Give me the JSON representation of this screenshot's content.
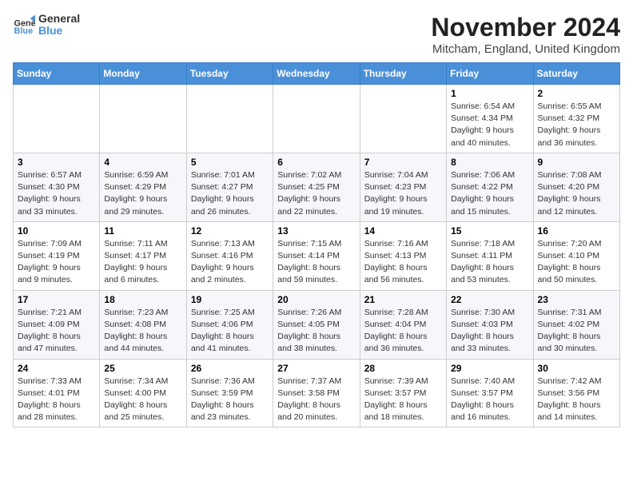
{
  "header": {
    "logo_general": "General",
    "logo_blue": "Blue",
    "month_title": "November 2024",
    "location": "Mitcham, England, United Kingdom"
  },
  "days_of_week": [
    "Sunday",
    "Monday",
    "Tuesday",
    "Wednesday",
    "Thursday",
    "Friday",
    "Saturday"
  ],
  "weeks": [
    [
      {
        "day": "",
        "info": ""
      },
      {
        "day": "",
        "info": ""
      },
      {
        "day": "",
        "info": ""
      },
      {
        "day": "",
        "info": ""
      },
      {
        "day": "",
        "info": ""
      },
      {
        "day": "1",
        "info": "Sunrise: 6:54 AM\nSunset: 4:34 PM\nDaylight: 9 hours\nand 40 minutes."
      },
      {
        "day": "2",
        "info": "Sunrise: 6:55 AM\nSunset: 4:32 PM\nDaylight: 9 hours\nand 36 minutes."
      }
    ],
    [
      {
        "day": "3",
        "info": "Sunrise: 6:57 AM\nSunset: 4:30 PM\nDaylight: 9 hours\nand 33 minutes."
      },
      {
        "day": "4",
        "info": "Sunrise: 6:59 AM\nSunset: 4:29 PM\nDaylight: 9 hours\nand 29 minutes."
      },
      {
        "day": "5",
        "info": "Sunrise: 7:01 AM\nSunset: 4:27 PM\nDaylight: 9 hours\nand 26 minutes."
      },
      {
        "day": "6",
        "info": "Sunrise: 7:02 AM\nSunset: 4:25 PM\nDaylight: 9 hours\nand 22 minutes."
      },
      {
        "day": "7",
        "info": "Sunrise: 7:04 AM\nSunset: 4:23 PM\nDaylight: 9 hours\nand 19 minutes."
      },
      {
        "day": "8",
        "info": "Sunrise: 7:06 AM\nSunset: 4:22 PM\nDaylight: 9 hours\nand 15 minutes."
      },
      {
        "day": "9",
        "info": "Sunrise: 7:08 AM\nSunset: 4:20 PM\nDaylight: 9 hours\nand 12 minutes."
      }
    ],
    [
      {
        "day": "10",
        "info": "Sunrise: 7:09 AM\nSunset: 4:19 PM\nDaylight: 9 hours\nand 9 minutes."
      },
      {
        "day": "11",
        "info": "Sunrise: 7:11 AM\nSunset: 4:17 PM\nDaylight: 9 hours\nand 6 minutes."
      },
      {
        "day": "12",
        "info": "Sunrise: 7:13 AM\nSunset: 4:16 PM\nDaylight: 9 hours\nand 2 minutes."
      },
      {
        "day": "13",
        "info": "Sunrise: 7:15 AM\nSunset: 4:14 PM\nDaylight: 8 hours\nand 59 minutes."
      },
      {
        "day": "14",
        "info": "Sunrise: 7:16 AM\nSunset: 4:13 PM\nDaylight: 8 hours\nand 56 minutes."
      },
      {
        "day": "15",
        "info": "Sunrise: 7:18 AM\nSunset: 4:11 PM\nDaylight: 8 hours\nand 53 minutes."
      },
      {
        "day": "16",
        "info": "Sunrise: 7:20 AM\nSunset: 4:10 PM\nDaylight: 8 hours\nand 50 minutes."
      }
    ],
    [
      {
        "day": "17",
        "info": "Sunrise: 7:21 AM\nSunset: 4:09 PM\nDaylight: 8 hours\nand 47 minutes."
      },
      {
        "day": "18",
        "info": "Sunrise: 7:23 AM\nSunset: 4:08 PM\nDaylight: 8 hours\nand 44 minutes."
      },
      {
        "day": "19",
        "info": "Sunrise: 7:25 AM\nSunset: 4:06 PM\nDaylight: 8 hours\nand 41 minutes."
      },
      {
        "day": "20",
        "info": "Sunrise: 7:26 AM\nSunset: 4:05 PM\nDaylight: 8 hours\nand 38 minutes."
      },
      {
        "day": "21",
        "info": "Sunrise: 7:28 AM\nSunset: 4:04 PM\nDaylight: 8 hours\nand 36 minutes."
      },
      {
        "day": "22",
        "info": "Sunrise: 7:30 AM\nSunset: 4:03 PM\nDaylight: 8 hours\nand 33 minutes."
      },
      {
        "day": "23",
        "info": "Sunrise: 7:31 AM\nSunset: 4:02 PM\nDaylight: 8 hours\nand 30 minutes."
      }
    ],
    [
      {
        "day": "24",
        "info": "Sunrise: 7:33 AM\nSunset: 4:01 PM\nDaylight: 8 hours\nand 28 minutes."
      },
      {
        "day": "25",
        "info": "Sunrise: 7:34 AM\nSunset: 4:00 PM\nDaylight: 8 hours\nand 25 minutes."
      },
      {
        "day": "26",
        "info": "Sunrise: 7:36 AM\nSunset: 3:59 PM\nDaylight: 8 hours\nand 23 minutes."
      },
      {
        "day": "27",
        "info": "Sunrise: 7:37 AM\nSunset: 3:58 PM\nDaylight: 8 hours\nand 20 minutes."
      },
      {
        "day": "28",
        "info": "Sunrise: 7:39 AM\nSunset: 3:57 PM\nDaylight: 8 hours\nand 18 minutes."
      },
      {
        "day": "29",
        "info": "Sunrise: 7:40 AM\nSunset: 3:57 PM\nDaylight: 8 hours\nand 16 minutes."
      },
      {
        "day": "30",
        "info": "Sunrise: 7:42 AM\nSunset: 3:56 PM\nDaylight: 8 hours\nand 14 minutes."
      }
    ]
  ]
}
